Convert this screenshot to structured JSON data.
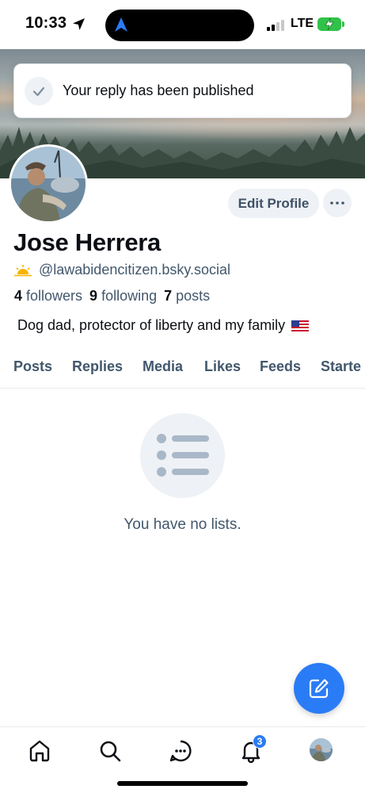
{
  "status_bar": {
    "time": "10:33",
    "network": "LTE",
    "signal_bars_active": 2,
    "signal_bars_total": 4,
    "battery_state": "charging",
    "battery_color": "#31c24a"
  },
  "toast": {
    "message": "Your reply has been published",
    "icon": "check-icon"
  },
  "profile": {
    "display_name": "Jose Herrera",
    "handle": "@lawabidencitizen.bsky.social",
    "handle_icon": "sun-emoji",
    "followers_count": "4",
    "followers_label": "followers",
    "following_count": "9",
    "following_label": "following",
    "posts_count": "7",
    "posts_label": "posts",
    "bio": "Dog dad, protector of liberty and my family",
    "bio_emoji": "us-flag"
  },
  "actions": {
    "edit_profile_label": "Edit Profile",
    "more_icon": "ellipsis-icon"
  },
  "tabs": {
    "items": [
      {
        "label": "Posts"
      },
      {
        "label": "Replies"
      },
      {
        "label": "Media"
      },
      {
        "label": "Likes"
      },
      {
        "label": "Feeds"
      },
      {
        "label": "Starte"
      }
    ]
  },
  "empty_state": {
    "icon": "list-icon",
    "message": "You have no lists."
  },
  "fab": {
    "icon": "compose-icon"
  },
  "bottom_nav": {
    "items": [
      "home-icon",
      "search-icon",
      "chat-icon",
      "notifications-icon",
      "profile-avatar"
    ],
    "notification_badge": "3"
  },
  "colors": {
    "accent": "#2a7cf6",
    "text_primary": "#0b0f14",
    "text_secondary": "#42576c",
    "chip_bg": "#eef1f5"
  }
}
